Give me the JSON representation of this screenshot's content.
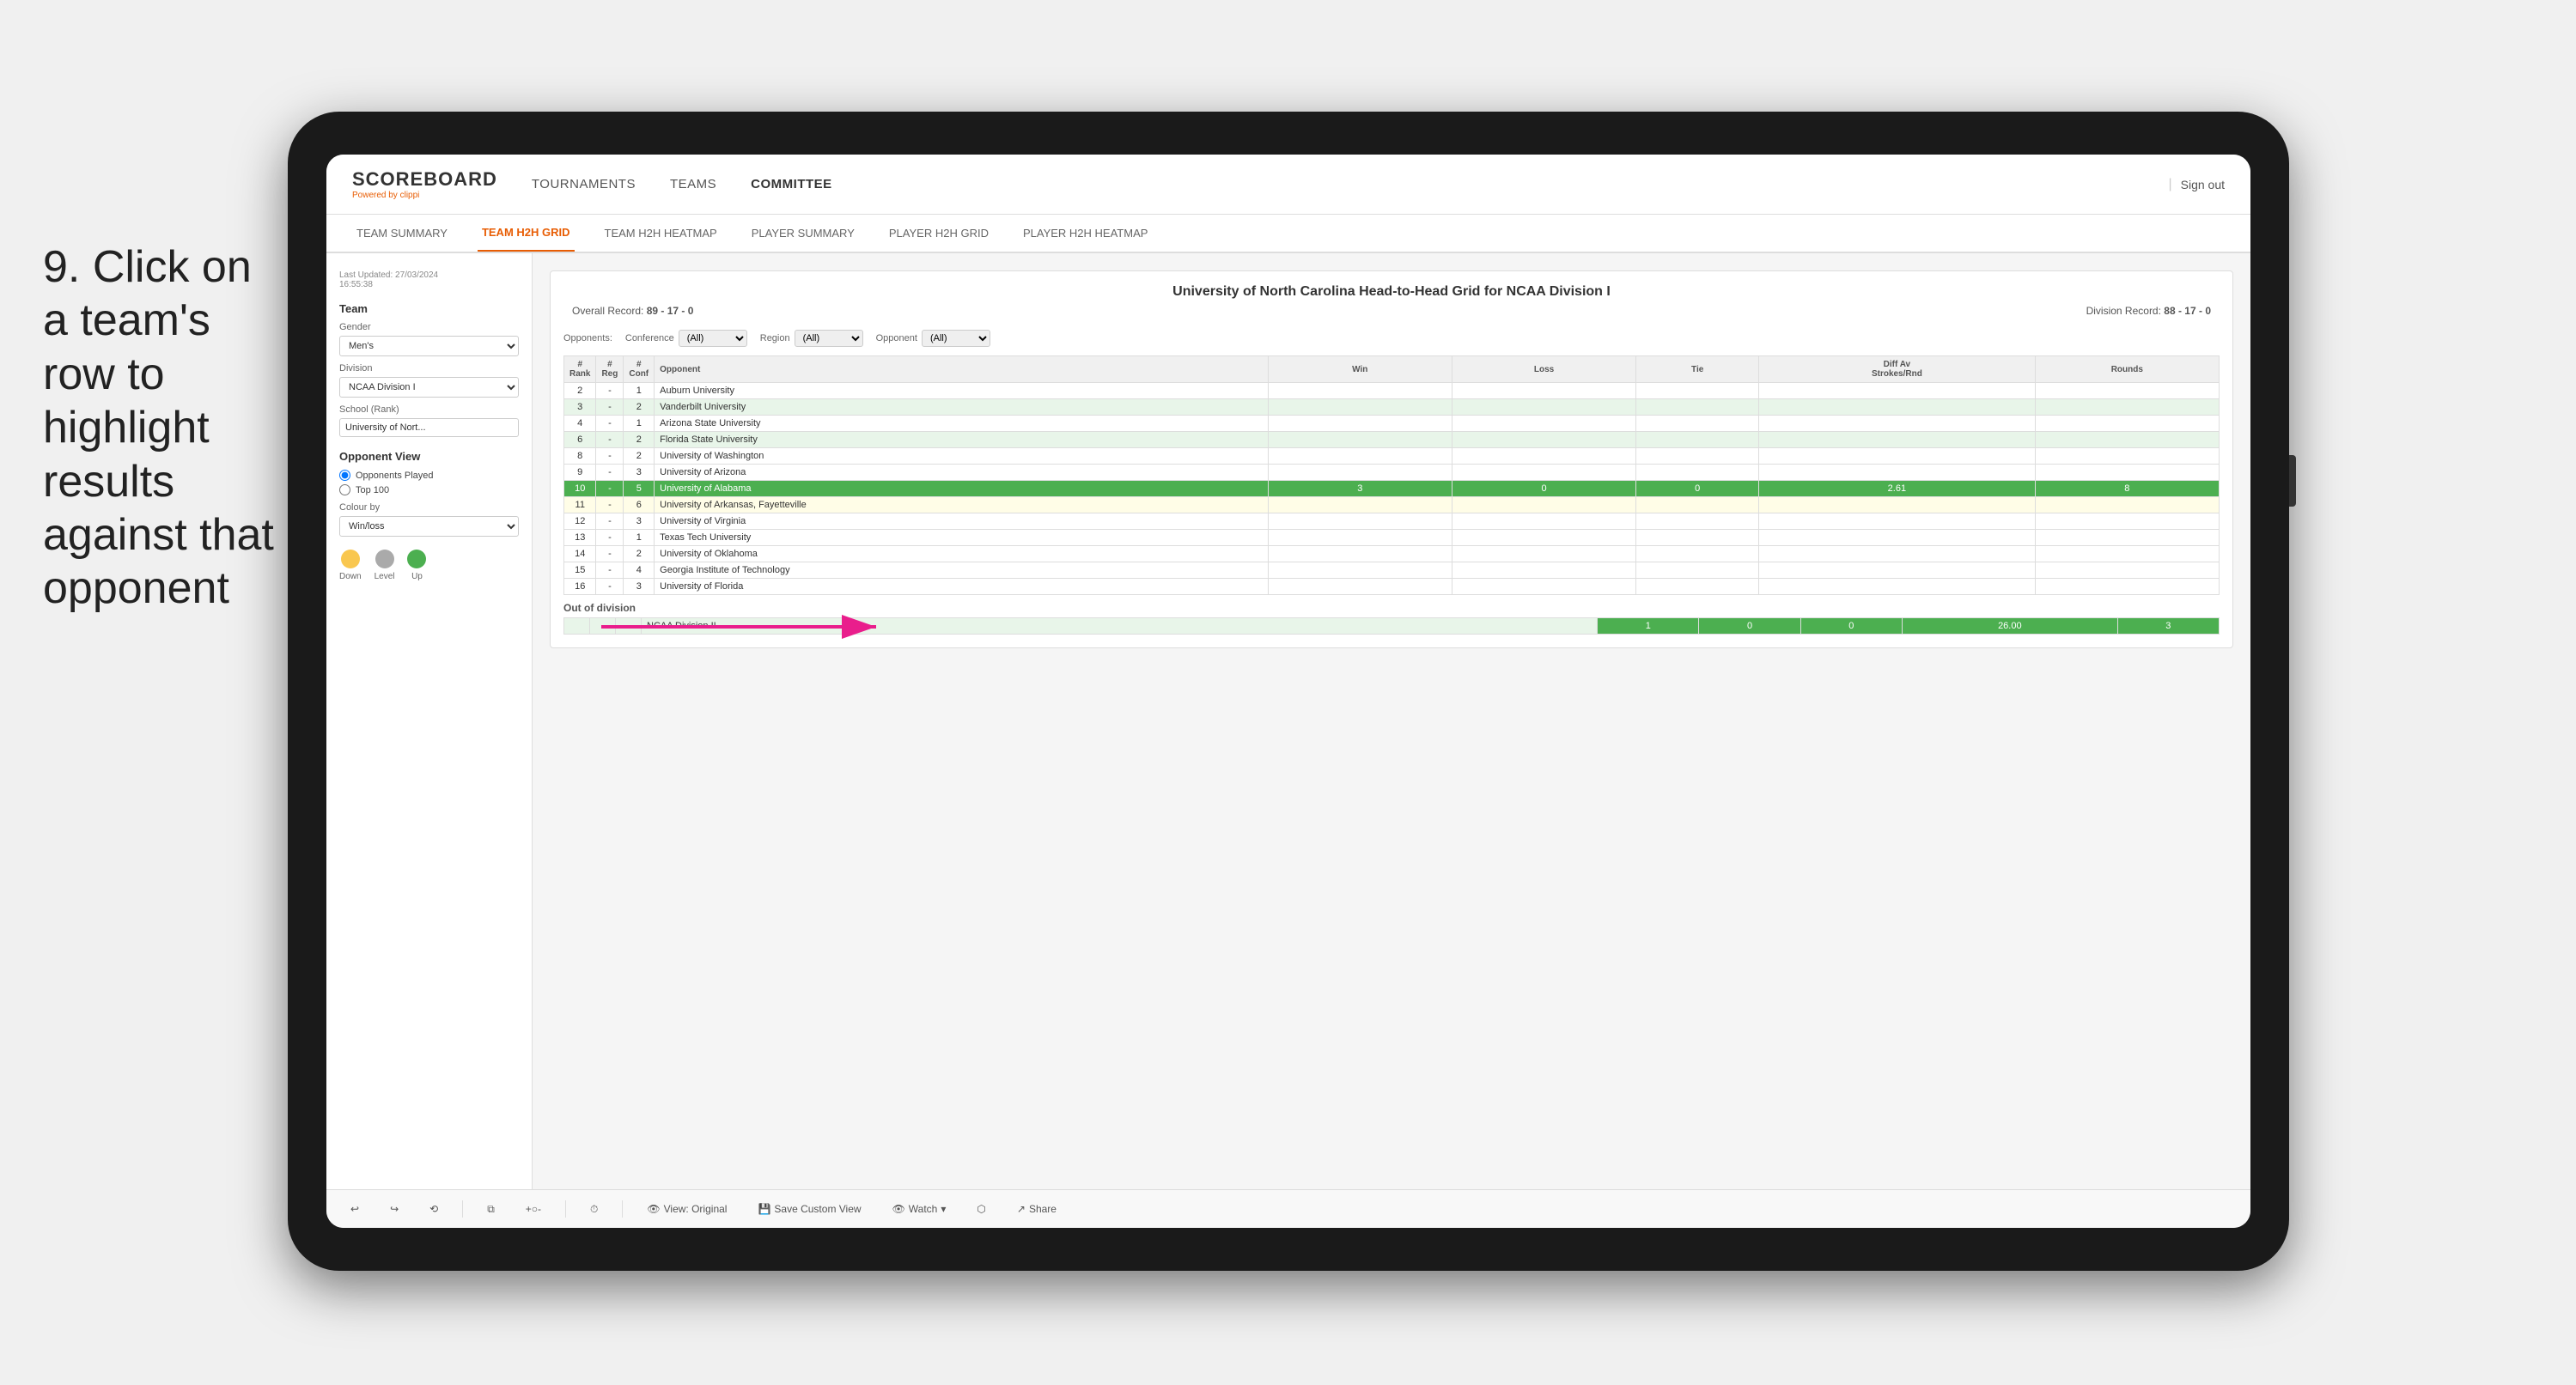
{
  "instruction": {
    "text": "9. Click on a team's row to highlight results against that opponent"
  },
  "nav": {
    "logo": "SCOREBOARD",
    "powered_by": "Powered by",
    "powered_brand": "clippi",
    "items": [
      "TOURNAMENTS",
      "TEAMS",
      "COMMITTEE"
    ],
    "sign_out": "Sign out"
  },
  "sub_nav": {
    "items": [
      "TEAM SUMMARY",
      "TEAM H2H GRID",
      "TEAM H2H HEATMAP",
      "PLAYER SUMMARY",
      "PLAYER H2H GRID",
      "PLAYER H2H HEATMAP"
    ],
    "active": "TEAM H2H GRID"
  },
  "sidebar": {
    "timestamp_label": "Last Updated: 27/03/2024",
    "time": "16:55:38",
    "team_label": "Team",
    "gender_label": "Gender",
    "gender_value": "Men's",
    "division_label": "Division",
    "division_value": "NCAA Division I",
    "school_label": "School (Rank)",
    "school_value": "University of Nort...",
    "opponent_view_label": "Opponent View",
    "opponents_played": "Opponents Played",
    "top100": "Top 100",
    "colour_by_label": "Colour by",
    "colour_by_value": "Win/loss",
    "legend": {
      "down": "Down",
      "level": "Level",
      "up": "Up"
    }
  },
  "grid": {
    "title": "University of North Carolina Head-to-Head Grid for NCAA Division I",
    "overall_record_label": "Overall Record:",
    "overall_record": "89 - 17 - 0",
    "division_record_label": "Division Record:",
    "division_record": "88 - 17 - 0",
    "filters": {
      "conference_label": "Conference",
      "conference_value": "(All)",
      "region_label": "Region",
      "region_value": "(All)",
      "opponent_label": "Opponent",
      "opponent_value": "(All)",
      "opponents_label": "Opponents:"
    },
    "columns": {
      "rank": "#\nRank",
      "reg": "#\nReg",
      "conf": "#\nConf",
      "opponent": "Opponent",
      "win": "Win",
      "loss": "Loss",
      "tie": "Tie",
      "diff": "Diff Av\nStrokes/Rnd",
      "rounds": "Rounds"
    },
    "rows": [
      {
        "rank": "2",
        "reg": "-",
        "conf": "1",
        "opponent": "Auburn University",
        "win": "",
        "loss": "",
        "tie": "",
        "diff": "",
        "rounds": "",
        "style": ""
      },
      {
        "rank": "3",
        "reg": "-",
        "conf": "2",
        "opponent": "Vanderbilt University",
        "win": "",
        "loss": "",
        "tie": "",
        "diff": "",
        "rounds": "",
        "style": "light-green"
      },
      {
        "rank": "4",
        "reg": "-",
        "conf": "1",
        "opponent": "Arizona State University",
        "win": "",
        "loss": "",
        "tie": "",
        "diff": "",
        "rounds": "",
        "style": ""
      },
      {
        "rank": "6",
        "reg": "-",
        "conf": "2",
        "opponent": "Florida State University",
        "win": "",
        "loss": "",
        "tie": "",
        "diff": "",
        "rounds": "",
        "style": "light-green"
      },
      {
        "rank": "8",
        "reg": "-",
        "conf": "2",
        "opponent": "University of Washington",
        "win": "",
        "loss": "",
        "tie": "",
        "diff": "",
        "rounds": "",
        "style": ""
      },
      {
        "rank": "9",
        "reg": "-",
        "conf": "3",
        "opponent": "University of Arizona",
        "win": "",
        "loss": "",
        "tie": "",
        "diff": "",
        "rounds": "",
        "style": ""
      },
      {
        "rank": "10",
        "reg": "-",
        "conf": "5",
        "opponent": "University of Alabama",
        "win": "3",
        "loss": "0",
        "tie": "0",
        "diff": "2.61",
        "rounds": "8",
        "style": "highlighted"
      },
      {
        "rank": "11",
        "reg": "-",
        "conf": "6",
        "opponent": "University of Arkansas, Fayetteville",
        "win": "",
        "loss": "",
        "tie": "",
        "diff": "",
        "rounds": "",
        "style": "light-yellow"
      },
      {
        "rank": "12",
        "reg": "-",
        "conf": "3",
        "opponent": "University of Virginia",
        "win": "",
        "loss": "",
        "tie": "",
        "diff": "",
        "rounds": "",
        "style": ""
      },
      {
        "rank": "13",
        "reg": "-",
        "conf": "1",
        "opponent": "Texas Tech University",
        "win": "",
        "loss": "",
        "tie": "",
        "diff": "",
        "rounds": "",
        "style": ""
      },
      {
        "rank": "14",
        "reg": "-",
        "conf": "2",
        "opponent": "University of Oklahoma",
        "win": "",
        "loss": "",
        "tie": "",
        "diff": "",
        "rounds": "",
        "style": ""
      },
      {
        "rank": "15",
        "reg": "-",
        "conf": "4",
        "opponent": "Georgia Institute of Technology",
        "win": "",
        "loss": "",
        "tie": "",
        "diff": "",
        "rounds": "",
        "style": ""
      },
      {
        "rank": "16",
        "reg": "-",
        "conf": "3",
        "opponent": "University of Florida",
        "win": "",
        "loss": "",
        "tie": "",
        "diff": "",
        "rounds": "",
        "style": ""
      }
    ],
    "out_of_division": {
      "label": "Out of division",
      "row": {
        "division": "NCAA Division II",
        "win": "1",
        "loss": "0",
        "tie": "0",
        "diff": "26.00",
        "rounds": "3"
      }
    }
  },
  "toolbar": {
    "view_original": "View: Original",
    "save_custom_view": "Save Custom View",
    "watch": "Watch",
    "share": "Share"
  },
  "colors": {
    "active_tab": "#e85d04",
    "highlighted_row": "#4caf50",
    "light_green": "#e8f5e9",
    "light_yellow": "#fffde7",
    "legend_down": "#f9c74f",
    "legend_level": "#aaa",
    "legend_up": "#4caf50",
    "pink_arrow": "#e91e8c"
  }
}
